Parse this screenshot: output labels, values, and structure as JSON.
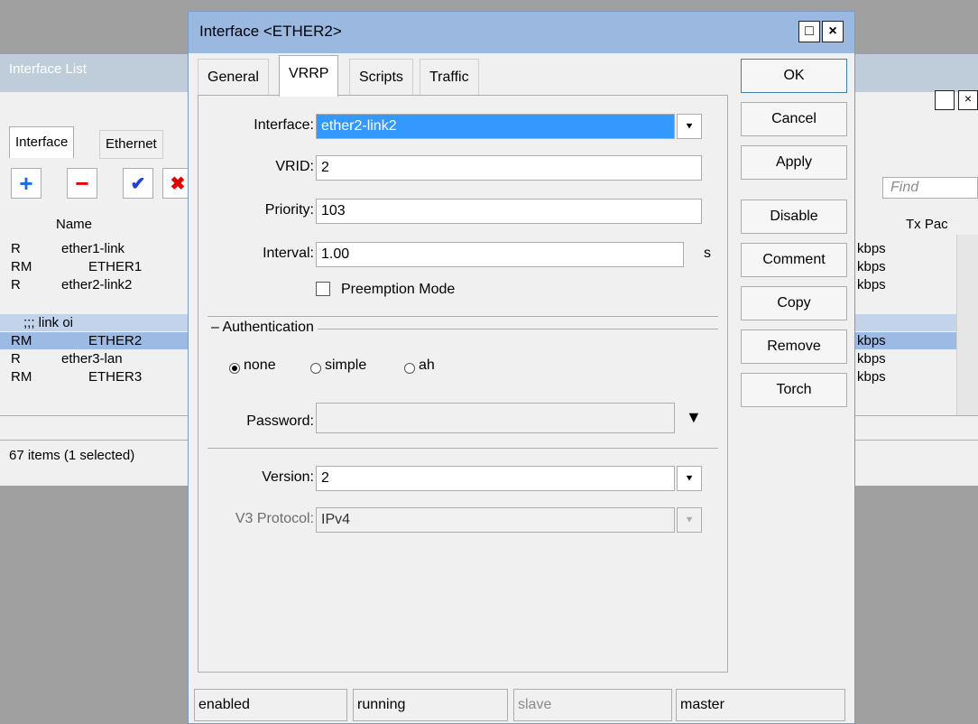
{
  "background_window": {
    "title": "Interface List",
    "tabs": [
      "Interface",
      "Ethernet"
    ],
    "toolbar": {
      "add_icon": "plus-icon",
      "remove_icon": "minus-icon",
      "enable_icon": "check-icon",
      "disable_icon": "x-icon"
    },
    "columns": {
      "name": "Name",
      "tx_packets": "Tx Pac"
    },
    "find_placeholder": "Find",
    "rows": [
      {
        "flag": "R",
        "name": "ether1-link",
        "rate": "kbps"
      },
      {
        "flag": "RM",
        "name": "ETHER1",
        "rate": "kbps"
      },
      {
        "flag": "R",
        "name": "ether2-link2",
        "rate": "kbps"
      },
      {
        "flag": "",
        "name": ";;; link oi",
        "rate": ""
      },
      {
        "flag": "RM",
        "name": "ETHER2",
        "rate": "kbps"
      },
      {
        "flag": "R",
        "name": "ether3-lan",
        "rate": "kbps"
      },
      {
        "flag": "RM",
        "name": "ETHER3",
        "rate": "kbps"
      }
    ],
    "status": "67 items (1 selected)"
  },
  "dialog": {
    "title": "Interface <ETHER2>",
    "tabs": [
      "General",
      "VRRP",
      "Scripts",
      "Traffic"
    ],
    "active_tab": "VRRP",
    "fields": {
      "interface_label": "Interface:",
      "interface_value": "ether2-link2",
      "vrid_label": "VRID:",
      "vrid_value": "2",
      "priority_label": "Priority:",
      "priority_value": "103",
      "interval_label": "Interval:",
      "interval_value": "1.00",
      "interval_unit": "s",
      "preemption_label": "Preemption Mode",
      "auth_group": "Authentication",
      "auth_options": [
        "none",
        "simple",
        "ah"
      ],
      "auth_selected": "none",
      "password_label": "Password:",
      "password_value": "",
      "version_label": "Version:",
      "version_value": "2",
      "v3_label": "V3 Protocol:",
      "v3_value": "IPv4"
    },
    "buttons": [
      "OK",
      "Cancel",
      "Apply",
      "Disable",
      "Comment",
      "Copy",
      "Remove",
      "Torch"
    ],
    "status_bar": [
      "enabled",
      "running",
      "slave",
      "master"
    ]
  }
}
